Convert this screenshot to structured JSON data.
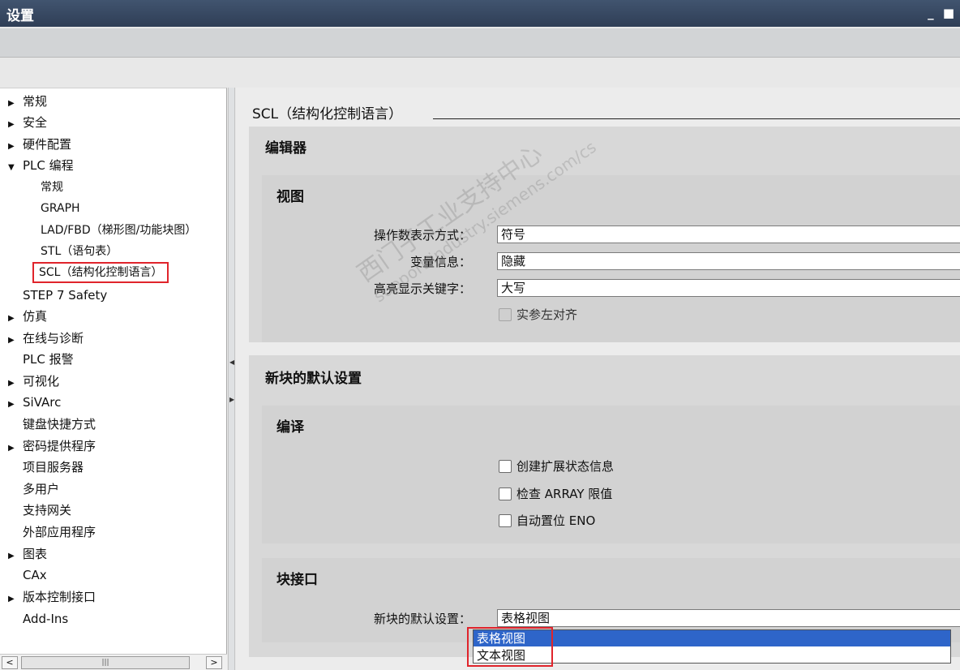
{
  "window": {
    "title": "设置",
    "controls": "_ ■"
  },
  "nav": {
    "items": [
      {
        "label": "常规",
        "expandable": true
      },
      {
        "label": "安全",
        "expandable": true
      },
      {
        "label": "硬件配置",
        "expandable": true
      },
      {
        "label": "PLC 编程",
        "expanded": true
      },
      {
        "label": "常规",
        "child": true
      },
      {
        "label": "GRAPH",
        "child": true
      },
      {
        "label": "LAD/FBD（梯形图/功能块图）",
        "child": true
      },
      {
        "label": "STL（语句表）",
        "child": true
      },
      {
        "label": "SCL（结构化控制语言）",
        "child": true,
        "selected": true
      },
      {
        "label": "STEP 7 Safety"
      },
      {
        "label": "仿真",
        "expandable": true
      },
      {
        "label": "在线与诊断",
        "expandable": true
      },
      {
        "label": "PLC 报警"
      },
      {
        "label": "可视化",
        "expandable": true
      },
      {
        "label": "SiVArc",
        "expandable": true
      },
      {
        "label": "键盘快捷方式"
      },
      {
        "label": "密码提供程序",
        "expandable": true
      },
      {
        "label": "项目服务器"
      },
      {
        "label": "多用户"
      },
      {
        "label": "支持网关"
      },
      {
        "label": "外部应用程序"
      },
      {
        "label": "图表",
        "expandable": true
      },
      {
        "label": "CAx"
      },
      {
        "label": "版本控制接口",
        "expandable": true
      },
      {
        "label": "Add-Ins"
      }
    ],
    "scroll_left": "<",
    "scroll_right": ">",
    "scroll_grip": "|||"
  },
  "main": {
    "heading": "SCL（结构化控制语言）",
    "editor": {
      "title": "编辑器",
      "view": {
        "title": "视图",
        "operand_label": "操作数表示方式：",
        "operand_value": "符号",
        "varinfo_label": "变量信息：",
        "varinfo_value": "隐藏",
        "keyword_label": "高亮显示关键字：",
        "keyword_value": "大写",
        "align_label": "实参左对齐"
      }
    },
    "new_block": {
      "title": "新块的默认设置",
      "compile": {
        "title": "编译",
        "opt1": "创建扩展状态信息",
        "opt2": "检查 ARRAY 限值",
        "opt3": "自动置位 ENO"
      },
      "interface": {
        "title": "块接口",
        "default_label": "新块的默认设置：",
        "default_value": "表格视图",
        "options": [
          "表格视图",
          "文本视图"
        ]
      }
    }
  },
  "watermark": {
    "line1": "西门子工业支持中心",
    "line2": "support.industry.siemens.com/cs"
  },
  "colors": {
    "titlebar": "#2f3e56",
    "selection": "#2e65c9",
    "highlight_box": "#e0242b"
  }
}
